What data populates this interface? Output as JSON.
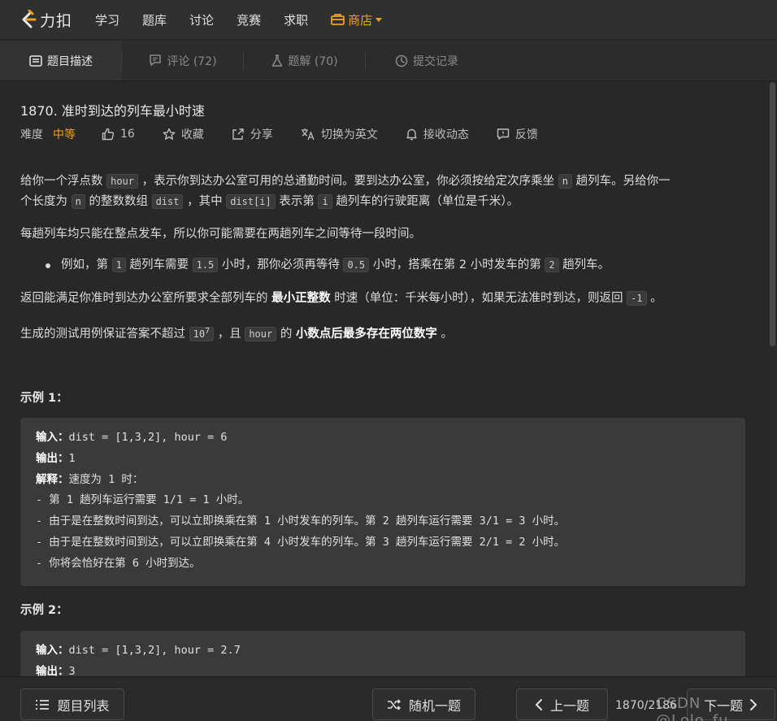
{
  "nav": {
    "logo_text": "力扣",
    "items": [
      "学习",
      "题库",
      "讨论",
      "竞赛",
      "求职"
    ],
    "store": "商店"
  },
  "tabs": [
    {
      "label": "题目描述",
      "icon": "description-icon"
    },
    {
      "label": "评论 (72)",
      "icon": "comment-icon"
    },
    {
      "label": "题解 (70)",
      "icon": "flask-icon"
    },
    {
      "label": "提交记录",
      "icon": "history-icon"
    }
  ],
  "problem": {
    "title": "1870. 准时到达的列车最小时速",
    "difficulty_label": "难度",
    "difficulty": "中等",
    "likes": "16",
    "favorite": "收藏",
    "share": "分享",
    "switch_lang": "切换为英文",
    "subscribe": "接收动态",
    "feedback": "反馈"
  },
  "description": {
    "p1_a": "给你一个浮点数 ",
    "p1_code1": "hour",
    "p1_b": " ，表示你到达办公室可用的总通勤时间。要到达办公室，你必须按给定次序乘坐 ",
    "p1_code2": "n",
    "p1_c": " 趟列车。另给你一",
    "p1_d": "个长度为 ",
    "p1_code3": "n",
    "p1_e": " 的整数数组 ",
    "p1_code4": "dist",
    "p1_f": " ，其中 ",
    "p1_code5": "dist[i]",
    "p1_g": " 表示第 ",
    "p1_code6": "i",
    "p1_h": " 趟列车的行驶距离（单位是千米）。",
    "p2": "每趟列车均只能在整点发车，所以你可能需要在两趟列车之间等待一段时间。",
    "b1_a": "例如，第 ",
    "b1_code1": "1",
    "b1_b": " 趟列车需要 ",
    "b1_code2": "1.5",
    "b1_c": " 小时，那你必须再等待 ",
    "b1_code3": "0.5",
    "b1_d": " 小时，搭乘在第 2 小时发车的第 ",
    "b1_code4": "2",
    "b1_e": " 趟列车。",
    "p3_a": "返回能满足你准时到达办公室所要求全部列车的 ",
    "p3_bold": "最小正整数",
    "p3_b": " 时速（单位：千米每小时），如果无法准时到达，则返回 ",
    "p3_code": "-1",
    "p3_c": " 。",
    "p4_a": "生成的测试用例保证答案不超过 ",
    "p4_code_base": "10",
    "p4_code_sup": "7",
    "p4_b": " ，且 ",
    "p4_code2": "hour",
    "p4_c": " 的 ",
    "p4_bold": "小数点后最多存在两位数字",
    "p4_d": " 。"
  },
  "example1": {
    "title": "示例 1：",
    "input_label": "输入：",
    "input": "dist = [1,3,2], hour = 6",
    "output_label": "输出：",
    "output": "1",
    "explain_label": "解释：",
    "explain": "速度为 1 时：",
    "lines": [
      "- 第 1 趟列车运行需要 1/1 = 1 小时。",
      "- 由于是在整数时间到达，可以立即换乘在第 1 小时发车的列车。第 2 趟列车运行需要 3/1 = 3 小时。",
      "- 由于是在整数时间到达，可以立即换乘在第 4 小时发车的列车。第 3 趟列车运行需要 2/1 = 2 小时。",
      "- 你将会恰好在第 6 小时到达。"
    ]
  },
  "example2": {
    "title": "示例 2：",
    "input_label": "输入：",
    "input": "dist = [1,3,2], hour = 2.7",
    "output_label": "输出：",
    "output": "3"
  },
  "bottom": {
    "problem_list": "题目列表",
    "random": "随机一题",
    "prev": "上一题",
    "counter": "1870/2186",
    "next": "下一题",
    "watermark": "CSDN @Lolo_fu"
  },
  "colors": {
    "accent": "#f0a020",
    "background": "#282828"
  }
}
